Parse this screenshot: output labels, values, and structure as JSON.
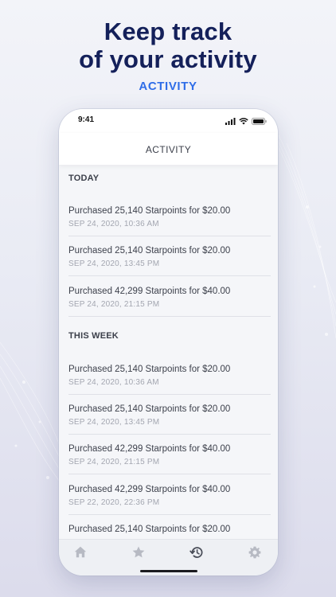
{
  "headline": {
    "line1": "Keep track",
    "line2": "of your activity"
  },
  "subhead": "ACTIVITY",
  "status_bar": {
    "time": "9:41",
    "icons": [
      "signal-icon",
      "wifi-icon",
      "battery-icon"
    ]
  },
  "nav": {
    "title": "ACTIVITY"
  },
  "sections": [
    {
      "title": "TODAY",
      "items": [
        {
          "title": "Purchased 25,140 Starpoints for $20.00",
          "date": "SEP 24, 2020, 10:36 AM"
        },
        {
          "title": "Purchased 25,140 Starpoints for $20.00",
          "date": "SEP 24, 2020, 13:45 PM"
        },
        {
          "title": "Purchased 42,299 Starpoints for $40.00",
          "date": "SEP 24, 2020, 21:15 PM"
        }
      ]
    },
    {
      "title": "THIS WEEK",
      "items": [
        {
          "title": "Purchased 25,140 Starpoints for $20.00",
          "date": "SEP 24, 2020, 10:36 AM"
        },
        {
          "title": "Purchased 25,140 Starpoints for $20.00",
          "date": "SEP 24, 2020, 13:45 PM"
        },
        {
          "title": "Purchased 42,299 Starpoints for $40.00",
          "date": "SEP 24, 2020, 21:15 PM"
        },
        {
          "title": "Purchased 42,299 Starpoints for $40.00",
          "date": "SEP 22, 2020, 22:36 PM"
        },
        {
          "title": "Purchased 25,140 Starpoints for $20.00",
          "date": ""
        }
      ]
    }
  ],
  "tab_bar": {
    "tabs": [
      {
        "icon": "home-icon",
        "active": false
      },
      {
        "icon": "star-icon",
        "active": false
      },
      {
        "icon": "history-icon",
        "active": true
      },
      {
        "icon": "gear-icon",
        "active": false
      }
    ]
  },
  "colors": {
    "headline": "#14205a",
    "accent": "#2f6de8",
    "text_primary": "#3d414c",
    "text_secondary": "#a3a6b0",
    "tab_inactive": "#b7bac3",
    "tab_active": "#4a4e59"
  }
}
